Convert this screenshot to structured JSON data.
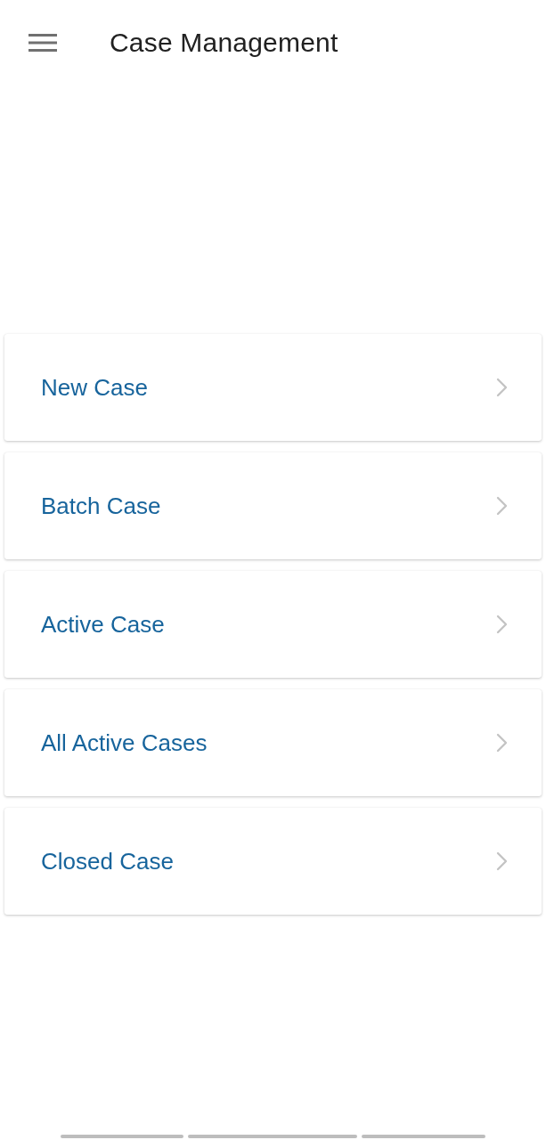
{
  "header": {
    "title": "Case Management"
  },
  "menu_items": [
    {
      "label": "New Case"
    },
    {
      "label": "Batch Case"
    },
    {
      "label": "Active Case"
    },
    {
      "label": "All Active Cases"
    },
    {
      "label": "Closed Case"
    }
  ]
}
